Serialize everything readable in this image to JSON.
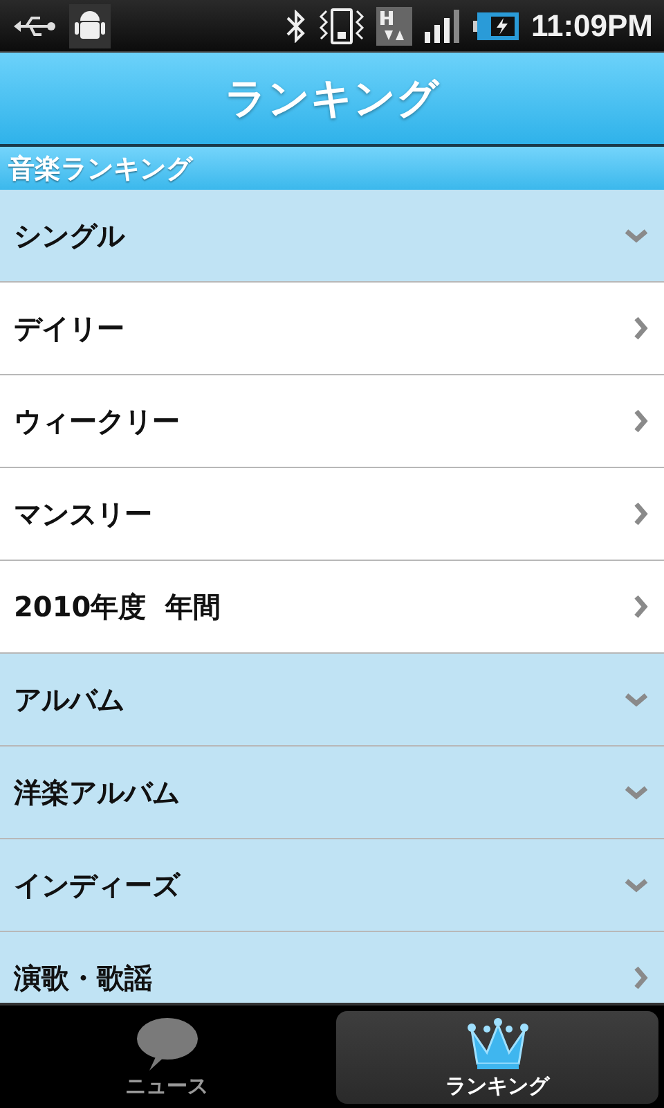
{
  "status_bar": {
    "time": "11:09PM"
  },
  "header": {
    "title": "ランキング"
  },
  "section": {
    "title": "音楽ランキング"
  },
  "rows": [
    {
      "label": "シングル",
      "kind": "group"
    },
    {
      "label": "デイリー",
      "kind": "item"
    },
    {
      "label": "ウィークリー",
      "kind": "item"
    },
    {
      "label": "マンスリー",
      "kind": "item"
    },
    {
      "label": "2010年度  年間",
      "kind": "item"
    },
    {
      "label": "アルバム",
      "kind": "group"
    },
    {
      "label": "洋楽アルバム",
      "kind": "group"
    },
    {
      "label": "インディーズ",
      "kind": "group"
    },
    {
      "label": "演歌・歌謡",
      "kind": "link"
    }
  ],
  "tabs": [
    {
      "label": "ニュース",
      "selected": false
    },
    {
      "label": "ランキング",
      "selected": true
    }
  ]
}
